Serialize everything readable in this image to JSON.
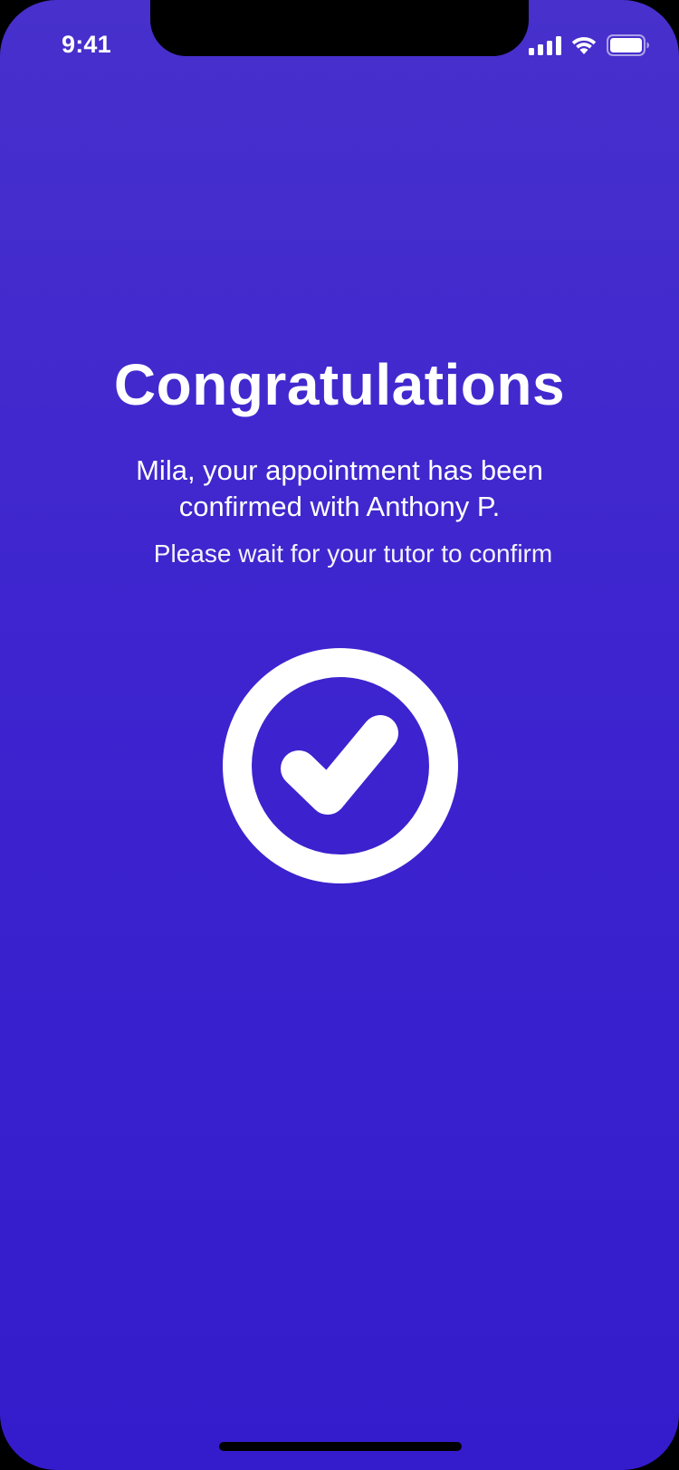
{
  "status_bar": {
    "time": "9:41",
    "icons": [
      "cellular-signal-icon",
      "wifi-icon",
      "battery-icon"
    ]
  },
  "confirmation": {
    "title": "Congratulations",
    "message": "Mila, your appointment has been confirmed with Anthony P.",
    "hint": "Please wait for your tutor to confirm",
    "icon": "check-circle-icon"
  },
  "colors": {
    "background_top": "#4730cc",
    "background_bottom": "#341ccc",
    "foreground": "#ffffff"
  }
}
